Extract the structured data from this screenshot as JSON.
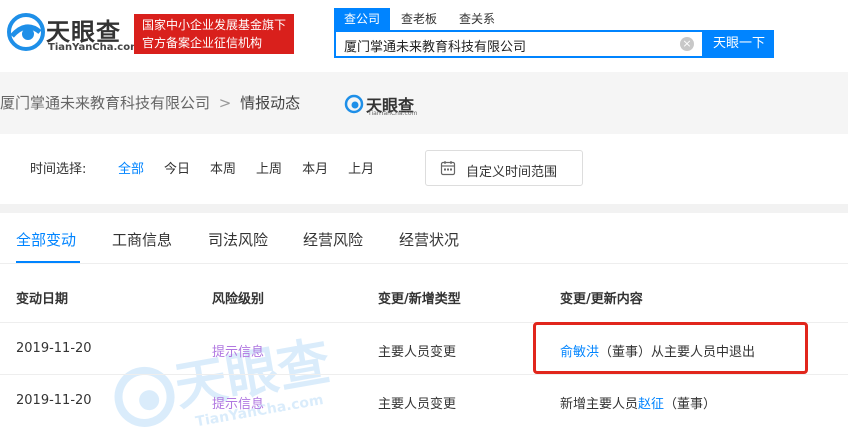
{
  "header": {
    "logo_text": "天眼查",
    "logo_sub": "TianYanCha.com",
    "promo_line1": "国家中小企业发展基金旗下",
    "promo_line2": "官方备案企业征信机构",
    "search_tabs": [
      "查公司",
      "查老板",
      "查关系"
    ],
    "search_value": "厦门掌通未来教育科技有限公司",
    "search_button": "天眼一下",
    "clear_icon": "close-circle-icon"
  },
  "breadcrumb": {
    "company": "厦门掌通未来教育科技有限公司",
    "separator": ">",
    "current": "情报动态",
    "mini_logo_text": "天眼查",
    "mini_logo_sub": "TianYanCha.com"
  },
  "filters": {
    "label": "时间选择:",
    "options": [
      "全部",
      "今日",
      "本周",
      "上周",
      "本月",
      "上月"
    ],
    "custom_range": "自定义时间范围",
    "calendar_icon": "calendar-icon"
  },
  "tabs": [
    "全部变动",
    "工商信息",
    "司法风险",
    "经营风险",
    "经营状况"
  ],
  "table": {
    "headers": [
      "变动日期",
      "风险级别",
      "变更/新增类型",
      "变更/更新内容"
    ],
    "rows": [
      {
        "date": "2019-11-20",
        "risk": "提示信息",
        "type": "主要人员变更",
        "content_link": "俞敏洪",
        "content_rest": "（董事）从主要人员中退出"
      },
      {
        "date": "2019-11-20",
        "risk": "提示信息",
        "type": "主要人员变更",
        "content_prefix": "新增主要人员",
        "content_link": "赵征",
        "content_rest": "（董事）"
      }
    ]
  },
  "watermark": {
    "text": "天眼查",
    "sub": "TianYanCha.com"
  },
  "colors": {
    "accent": "#0084ff",
    "promo_bg": "#d9201c",
    "risk_text": "#b077e0",
    "highlight_border": "#e1261c"
  }
}
